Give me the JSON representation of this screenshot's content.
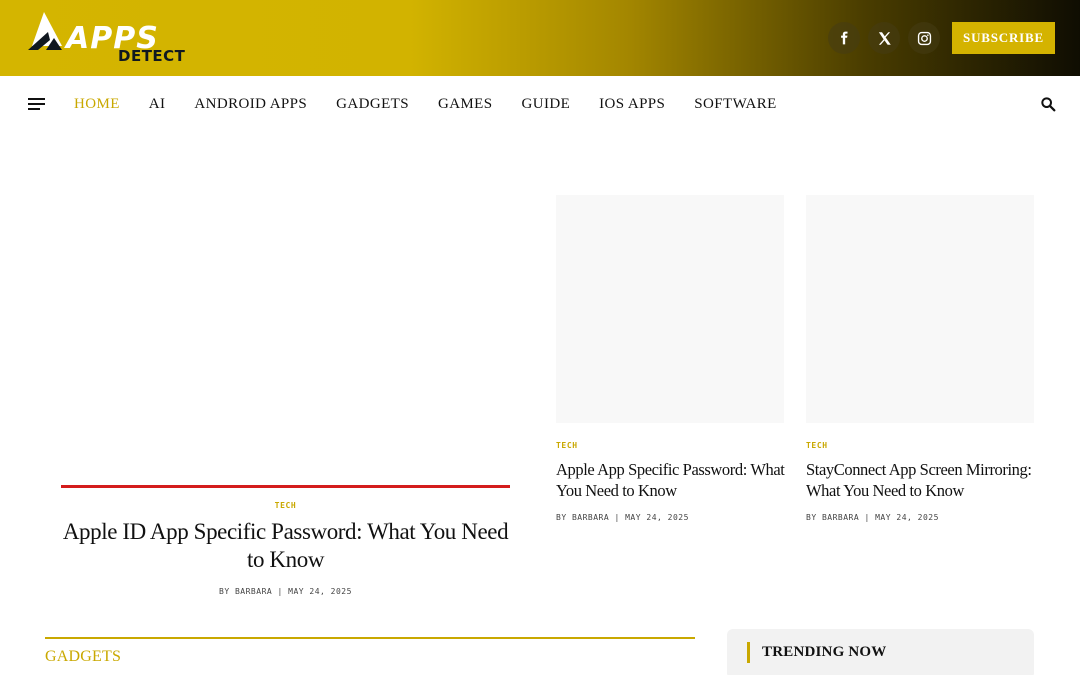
{
  "brand": {
    "logo_top": "APPS",
    "logo_bottom": "DETECT",
    "accent_color": "#c9a800",
    "header_gradient": [
      "#d4b500",
      "#0f0d02"
    ],
    "highlight_red": "#d41c1c"
  },
  "header": {
    "social": [
      {
        "icon": "facebook-icon"
      },
      {
        "icon": "x-icon"
      },
      {
        "icon": "instagram-icon"
      }
    ],
    "subscribe_label": "SUBSCRIBE"
  },
  "nav": {
    "menu_icon": "hamburger-menu-icon",
    "items": [
      {
        "label": "HOME",
        "active": true
      },
      {
        "label": "AI"
      },
      {
        "label": "ANDROID APPS"
      },
      {
        "label": "GADGETS"
      },
      {
        "label": "GAMES"
      },
      {
        "label": "GUIDE"
      },
      {
        "label": "IOS APPS"
      },
      {
        "label": "SOFTWARE"
      }
    ],
    "search_icon": "search-icon"
  },
  "featured": {
    "main": {
      "category": "TECH",
      "title": "Apple ID App Specific Password: What You Need to Know",
      "meta": "BY BARBARA | MAY 24, 2025"
    },
    "cards": [
      {
        "category": "TECH",
        "title": "Apple App Specific Password: What You Need to Know",
        "meta": "BY BARBARA | MAY 24, 2025"
      },
      {
        "category": "TECH",
        "title": "StayConnect App Screen Mirroring: What You Need to Know",
        "meta": "BY BARBARA | MAY 24, 2025"
      }
    ]
  },
  "sections": {
    "gadgets_title": "GADGETS",
    "trending_title": "TRENDING NOW"
  }
}
